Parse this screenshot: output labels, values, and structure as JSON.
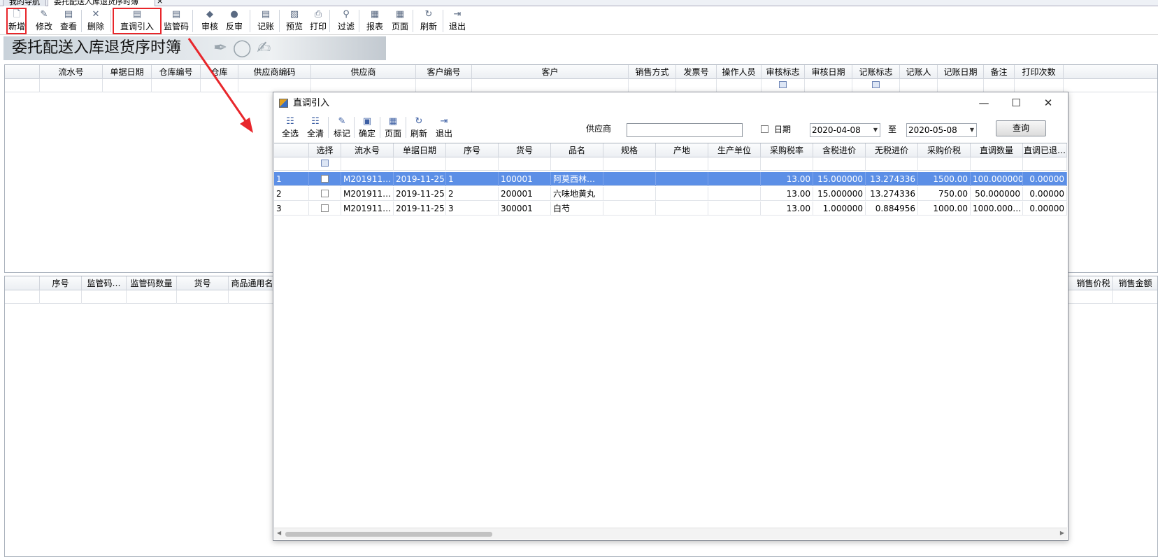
{
  "tabs": {
    "tab1": "我的导航",
    "tab2": "委托配送入库退货序时簿",
    "close": "×"
  },
  "toolbar": [
    {
      "key": "new",
      "label": "新增",
      "icon": "🗋"
    },
    {
      "key": "edit",
      "label": "修改",
      "icon": "✎"
    },
    {
      "key": "view",
      "label": "查看",
      "icon": "▤"
    },
    {
      "key": "delete",
      "label": "删除",
      "icon": "✕"
    },
    {
      "key": "direct-import",
      "label": "直调引入",
      "icon": "▤"
    },
    {
      "key": "supervision-code",
      "label": "监管码",
      "icon": "▤"
    },
    {
      "key": "audit",
      "label": "审核",
      "icon": "◆"
    },
    {
      "key": "unaudit",
      "label": "反审",
      "icon": "●"
    },
    {
      "key": "post",
      "label": "记账",
      "icon": "▤"
    },
    {
      "key": "preview",
      "label": "预览",
      "icon": "▧"
    },
    {
      "key": "print",
      "label": "打印",
      "icon": "⎙"
    },
    {
      "key": "filter",
      "label": "过滤",
      "icon": "⚲"
    },
    {
      "key": "report",
      "label": "报表",
      "icon": "▦"
    },
    {
      "key": "page",
      "label": "页面",
      "icon": "▦"
    },
    {
      "key": "refresh",
      "label": "刷新",
      "icon": "↻"
    },
    {
      "key": "exit",
      "label": "退出",
      "icon": "⇥"
    }
  ],
  "banner_title": "委托配送入库退货序时簿",
  "top_grid_headers": [
    "",
    "流水号",
    "单据日期",
    "仓库编号",
    "仓库",
    "供应商编码",
    "供应商",
    "客户编号",
    "客户",
    "销售方式",
    "发票号",
    "操作人员",
    "审核标志",
    "审核日期",
    "记账标志",
    "记账人",
    "记账日期",
    "备注",
    "打印次数"
  ],
  "bottom_grid_headers": [
    "",
    "序号",
    "监管码…",
    "监管码数量",
    "货号",
    "商品通用名称",
    "销售价税",
    "销售金额"
  ],
  "dialog": {
    "title": "直调引入",
    "min": "—",
    "max": "☐",
    "close": "✕",
    "toolbar": [
      {
        "key": "select-all",
        "label": "全选",
        "icon": "☷"
      },
      {
        "key": "clear-all",
        "label": "全清",
        "icon": "☷"
      },
      {
        "key": "mark",
        "label": "标记",
        "icon": "✎"
      },
      {
        "key": "confirm",
        "label": "确定",
        "icon": "▣"
      },
      {
        "key": "page",
        "label": "页面",
        "icon": "▦"
      },
      {
        "key": "refresh",
        "label": "刷新",
        "icon": "↻"
      },
      {
        "key": "exit",
        "label": "退出",
        "icon": "⇥"
      }
    ],
    "supplier_label": "供应商",
    "supplier_value": "",
    "date_label": "日期",
    "date_from": "2020-04-08",
    "to_label": "至",
    "date_to": "2020-05-08",
    "query_label": "查询",
    "headers": [
      "",
      "选择",
      "流水号",
      "单据日期",
      "序号",
      "货号",
      "品名",
      "规格",
      "产地",
      "生产单位",
      "采购税率",
      "含税进价",
      "无税进价",
      "采购价税",
      "直调数量",
      "直调已退…"
    ],
    "rows": [
      {
        "n": "1",
        "serial": "M201911…",
        "date": "2019-11-25",
        "seq": "1",
        "code": "100001",
        "name": "阿莫西林…",
        "spec": "",
        "origin": "",
        "maker": "",
        "tax": "13.00",
        "price_tax": "15.000000",
        "price_notax": "13.274336",
        "amount": "1500.00",
        "qty": "100.000000",
        "returned": "0.00000"
      },
      {
        "n": "2",
        "serial": "M201911…",
        "date": "2019-11-25",
        "seq": "2",
        "code": "200001",
        "name": "六味地黄丸",
        "spec": "",
        "origin": "",
        "maker": "",
        "tax": "13.00",
        "price_tax": "15.000000",
        "price_notax": "13.274336",
        "amount": "750.00",
        "qty": "50.000000",
        "returned": "0.00000"
      },
      {
        "n": "3",
        "serial": "M201911…",
        "date": "2019-11-25",
        "seq": "3",
        "code": "300001",
        "name": "白芍",
        "spec": "",
        "origin": "",
        "maker": "",
        "tax": "13.00",
        "price_tax": "1.000000",
        "price_notax": "0.884956",
        "amount": "1000.00",
        "qty": "1000.000…",
        "returned": "0.00000"
      }
    ]
  },
  "colors": {
    "highlight": "#e8262b",
    "selected_row": "#5c8fe6",
    "arrow": "#e8262b"
  }
}
